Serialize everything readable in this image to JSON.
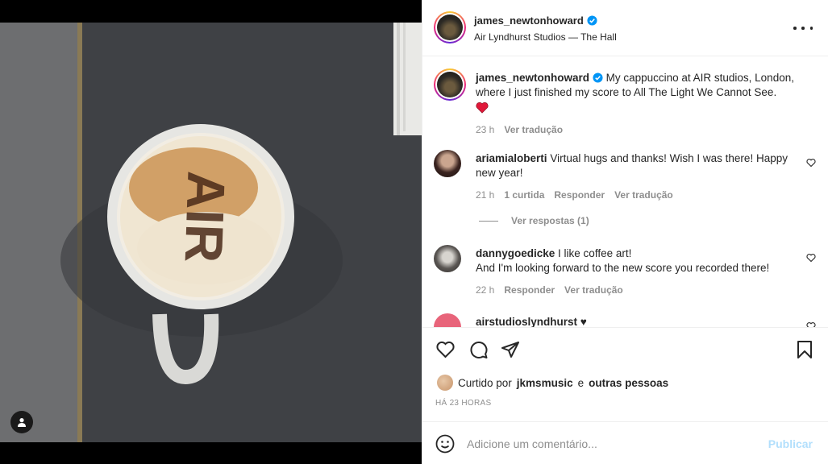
{
  "post": {
    "username": "james_newtonhoward",
    "location": "Air Lyndhurst Studios — The Hall",
    "caption": "My cappuccino at AIR studios, London, where I just finished my score to All The Light We Cannot See.",
    "caption_emoji": "❤️",
    "caption_time": "23 h",
    "translate_label": "Ver tradução",
    "latte_text": "AIR"
  },
  "comments": [
    {
      "username": "ariamialoberti",
      "text": "Virtual hugs and thanks! Wish I was there! Happy new year!",
      "time": "21 h",
      "likes": "1 curtida",
      "reply": "Responder",
      "translate": "Ver tradução"
    },
    {
      "username": "dannygoedicke",
      "text_line1": "I like coffee art!",
      "text_line2": "And I'm looking forward to the new score you recorded there!",
      "time": "22 h",
      "reply": "Responder",
      "translate": "Ver tradução"
    },
    {
      "username": "airstudioslyndhurst",
      "text": "♥"
    }
  ],
  "view_replies": "Ver respostas (1)",
  "likes": {
    "prefix": "Curtido por",
    "user": "jkmsmusic",
    "connector": "e",
    "others": "outras pessoas"
  },
  "timestamp": "HÁ 23 HORAS",
  "composer": {
    "placeholder": "Adicione um comentário...",
    "publish": "Publicar"
  },
  "colors": {
    "verified": "#0095f6",
    "heart": "#ed4956",
    "publish_disabled": "#b2dffc"
  }
}
